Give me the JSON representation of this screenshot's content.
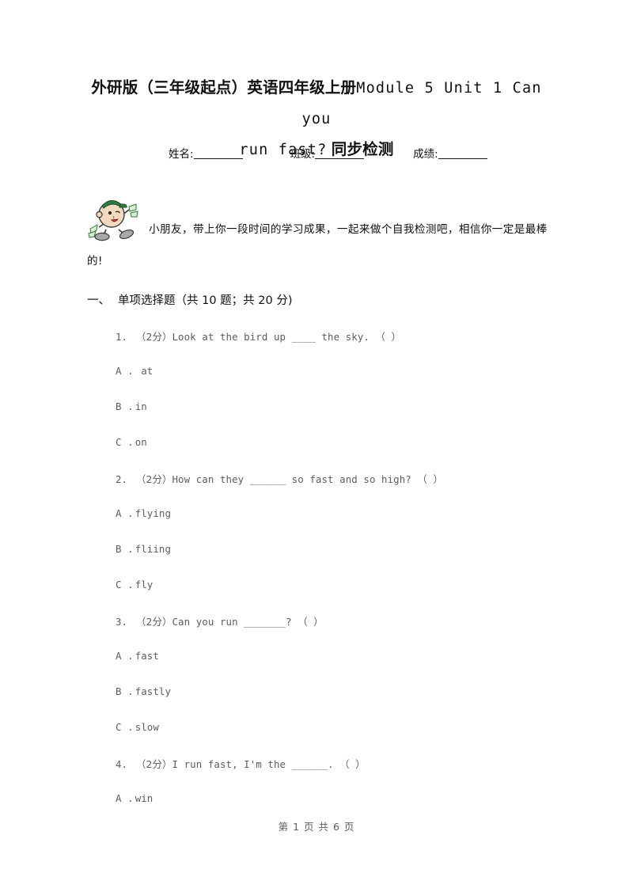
{
  "document": {
    "title_line_1_cn": "外研版（三年级起点）英语四年级上册",
    "title_line_1_en": "Module 5 Unit 1 Can you",
    "title_line_2_en": "run fast?",
    "title_line_2_cn": "同步检测"
  },
  "identity": {
    "name_label": "姓名:",
    "class_label": "班级:",
    "score_label": "成绩:"
  },
  "mascot": {
    "icon": "cartoon-student-mascot-icon",
    "cap_color": "#2f7a3e",
    "skin_color": "#f2d9c0",
    "shoe_color": "#a8a8a8"
  },
  "intro": {
    "text": "小朋友，带上你一段时间的学习成果，一起来做个自我检测吧，相信你一定是最棒的!"
  },
  "section": {
    "number": "一、",
    "title": "单项选择题（共 10 题；共 20 分)"
  },
  "questions": [
    {
      "number": "1.",
      "points": "（2分）",
      "stem": "Look at the bird up ____ the sky. （    ）",
      "options": [
        {
          "label": "A .",
          "text": "  at"
        },
        {
          "label": "B .",
          "text": "in"
        },
        {
          "label": "C .",
          "text": "on"
        }
      ]
    },
    {
      "number": "2.",
      "points": "（2分）",
      "stem": "How can they ______ so fast and so high? （    ）",
      "options": [
        {
          "label": "A .",
          "text": "flying"
        },
        {
          "label": "B .",
          "text": "fliing"
        },
        {
          "label": "C .",
          "text": "fly"
        }
      ]
    },
    {
      "number": "3.",
      "points": "（2分）",
      "stem": "Can you run _______? （    ）",
      "options": [
        {
          "label": "A .",
          "text": "fast"
        },
        {
          "label": "B .",
          "text": "fastly"
        },
        {
          "label": "C .",
          "text": "slow"
        }
      ]
    },
    {
      "number": "4.",
      "points": "（2分）",
      "stem": "I run fast, I'm the ______. （    ）",
      "options": [
        {
          "label": "A .",
          "text": "win"
        }
      ]
    }
  ],
  "footer": {
    "text": "第 1 页 共 6 页"
  }
}
